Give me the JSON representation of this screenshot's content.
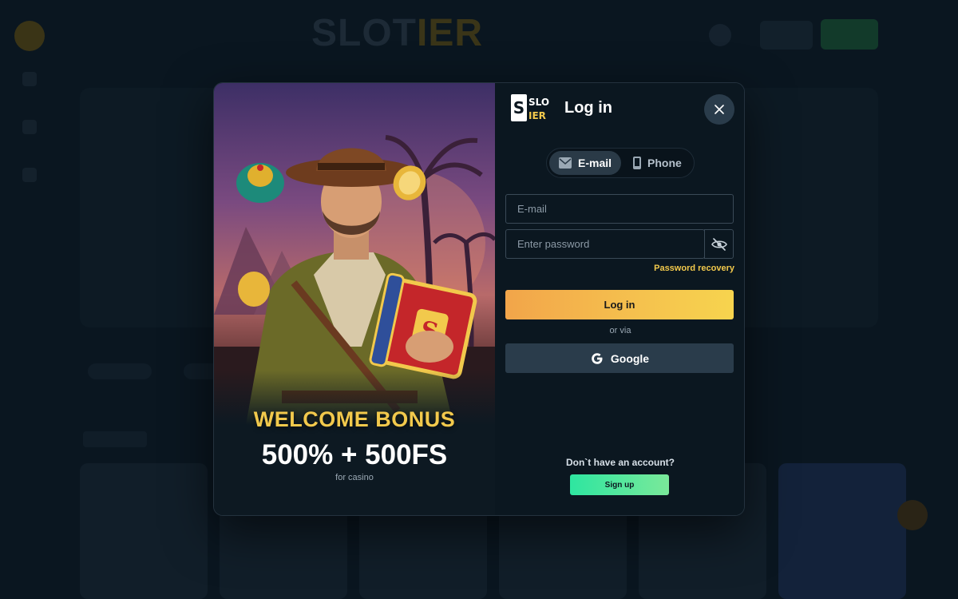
{
  "background": {
    "logo_text": "SLOT",
    "logo_accent": "IER"
  },
  "promo": {
    "welcome": "WELCOME BONUS",
    "bonus": "500% + 500FS",
    "subtitle": "for casino"
  },
  "login": {
    "brand_top": "SLOT",
    "brand_bottom": "IER",
    "title": "Log in",
    "tabs": [
      {
        "label": "E-mail",
        "icon": "envelope-icon",
        "active": true
      },
      {
        "label": "Phone",
        "icon": "phone-icon",
        "active": false
      }
    ],
    "email_placeholder": "E-mail",
    "password_placeholder": "Enter password",
    "password_recovery": "Password recovery",
    "submit": "Log in",
    "or_via": "or via",
    "google": "Google",
    "no_account": "Don`t have an account?",
    "signup": "Sign up"
  },
  "colors": {
    "accent_yellow": "#f2c94c",
    "login_gradient_start": "#f2a54a",
    "signup_green": "#2ee6a0",
    "panel_bg": "#0b1720"
  }
}
